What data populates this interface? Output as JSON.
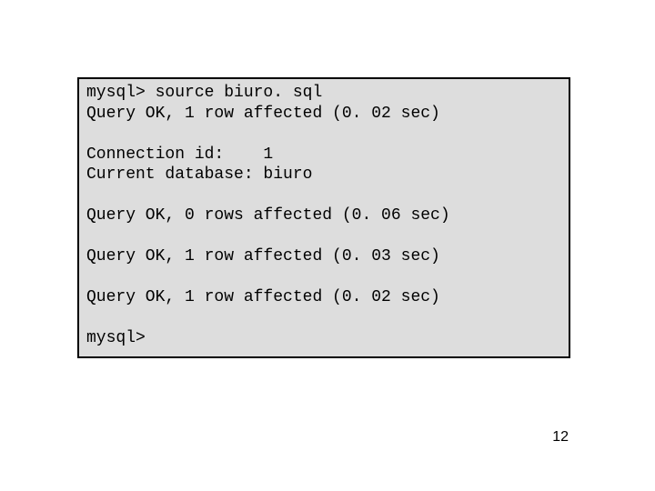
{
  "terminal": {
    "lines": [
      "mysql> source biuro. sql",
      "Query OK, 1 row affected (0. 02 sec)",
      "",
      "Connection id:    1",
      "Current database: biuro",
      "",
      "Query OK, 0 rows affected (0. 06 sec)",
      "",
      "Query OK, 1 row affected (0. 03 sec)",
      "",
      "Query OK, 1 row affected (0. 02 sec)",
      "",
      "mysql>"
    ]
  },
  "page_number": "12"
}
